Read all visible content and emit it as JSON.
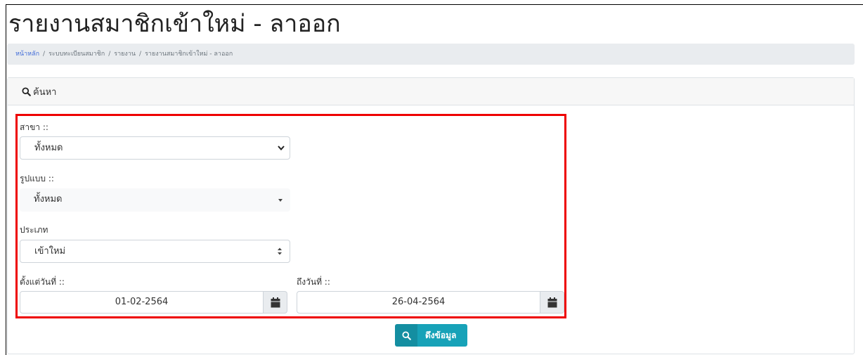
{
  "page": {
    "title": "รายงานสมาชิกเข้าใหม่ - ลาออก"
  },
  "breadcrumb": [
    "หน้าหลัก",
    "ระบบทะเบียนสมาชิก",
    "รายงาน",
    "รายงานสมาชิกเข้าใหม่ - ลาออก"
  ],
  "search_card": {
    "header": "ค้นหา",
    "header_icon": "search-icon"
  },
  "form": {
    "branch": {
      "label": "สาขา ::",
      "value": "ทั้งหมด"
    },
    "format": {
      "label": "รูปแบบ ::",
      "value": "ทั้งหมด"
    },
    "type": {
      "label": "ประเภท",
      "value": "เข้าใหม่"
    },
    "date_from": {
      "label": "ตั้งแต่วันที่ ::",
      "value": "01-02-2564"
    },
    "date_to": {
      "label": "ถึงวันที่ ::",
      "value": "26-04-2564"
    }
  },
  "fetch_button": {
    "label": "ดึงข้อมูล"
  },
  "colors": {
    "highlight": "#ee0000",
    "button": "#17a2b8",
    "link": "#3f6ad8"
  }
}
